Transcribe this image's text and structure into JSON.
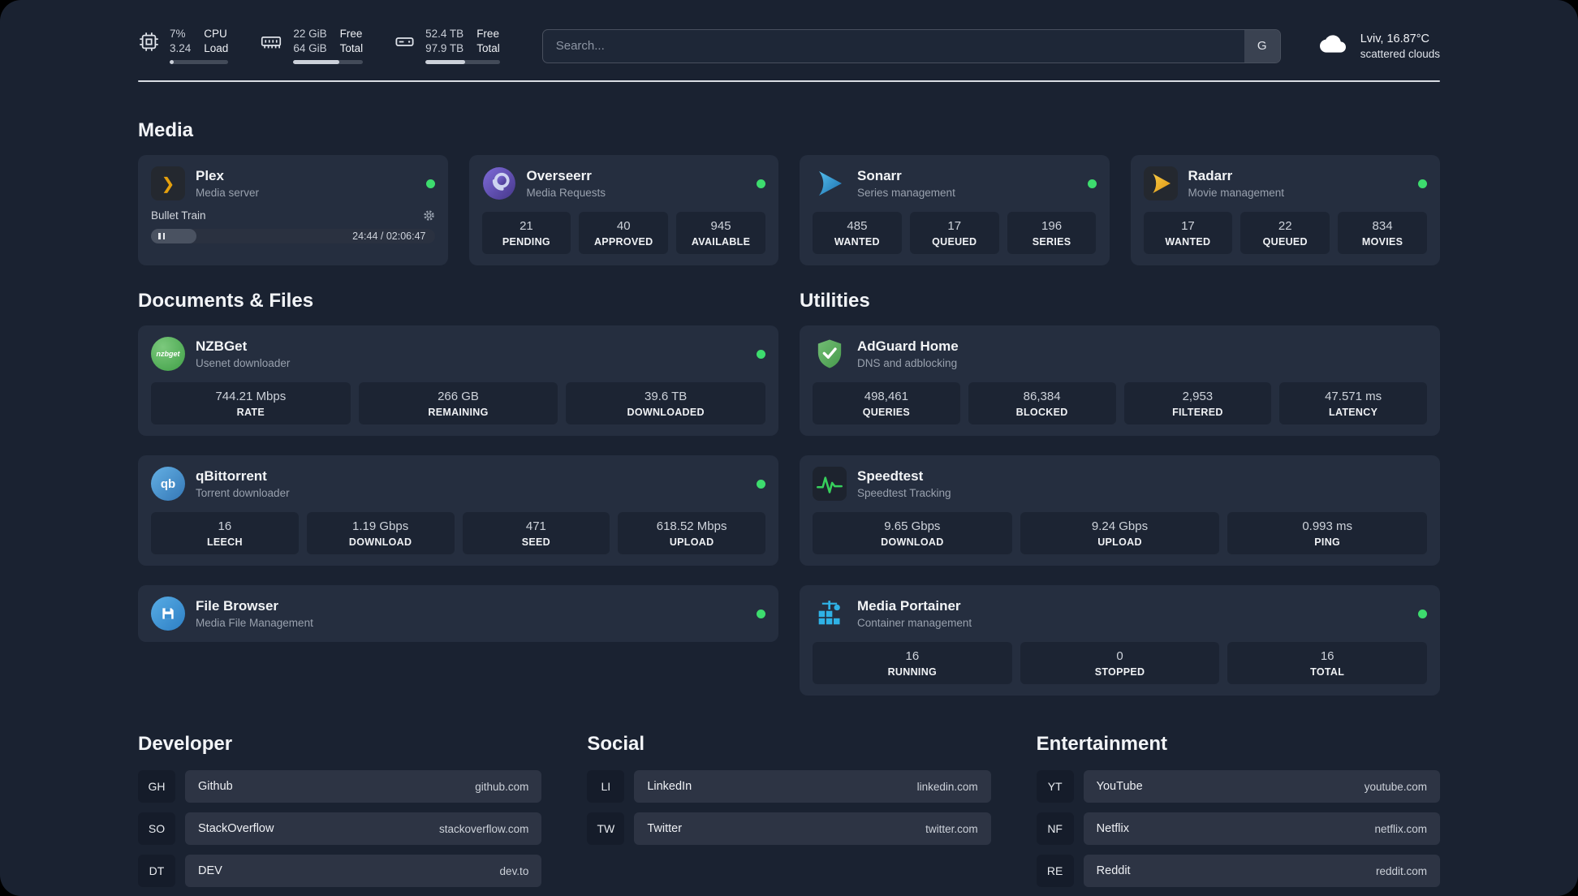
{
  "colors": {
    "background": "#1a2231",
    "card": "#252e3f",
    "tile": "#1c2433",
    "status_online": "#3ddc6e",
    "plex_gold": "#e5a00d",
    "text_primary": "#f2f4f6",
    "text_secondary": "#99a1ae"
  },
  "topbar": {
    "cpu": {
      "value1": "7%",
      "value2": "3.24",
      "label1": "CPU",
      "label2": "Load",
      "progress": 7
    },
    "memory": {
      "value1": "22 GiB",
      "value2": "64 GiB",
      "label1": "Free",
      "label2": "Total",
      "progress": 66
    },
    "disk": {
      "value1": "52.4 TB",
      "value2": "97.9 TB",
      "label1": "Free",
      "label2": "Total",
      "progress": 53
    },
    "search": {
      "placeholder": "Search...",
      "provider": "G"
    },
    "weather": {
      "location": "Lviv, 16.87°C",
      "condition": "scattered clouds"
    }
  },
  "sections": {
    "media": {
      "title": "Media",
      "cards": [
        {
          "name": "Plex",
          "desc": "Media server",
          "online": true,
          "icon_glyph": "❯",
          "player": {
            "track": "Bullet Train",
            "time": "24:44 / 02:06:47",
            "progress": 16
          }
        },
        {
          "name": "Overseerr",
          "desc": "Media Requests",
          "online": true,
          "stats": [
            {
              "value": "21",
              "label": "PENDING"
            },
            {
              "value": "40",
              "label": "APPROVED"
            },
            {
              "value": "945",
              "label": "AVAILABLE"
            }
          ]
        },
        {
          "name": "Sonarr",
          "desc": "Series management",
          "online": true,
          "stats": [
            {
              "value": "485",
              "label": "WANTED"
            },
            {
              "value": "17",
              "label": "QUEUED"
            },
            {
              "value": "196",
              "label": "SERIES"
            }
          ]
        },
        {
          "name": "Radarr",
          "desc": "Movie management",
          "online": true,
          "stats": [
            {
              "value": "17",
              "label": "WANTED"
            },
            {
              "value": "22",
              "label": "QUEUED"
            },
            {
              "value": "834",
              "label": "MOVIES"
            }
          ]
        }
      ]
    },
    "documents": {
      "title": "Documents & Files",
      "cards": [
        {
          "name": "NZBGet",
          "desc": "Usenet downloader",
          "online": true,
          "icon_text": "nzbget",
          "stats": [
            {
              "value": "744.21 Mbps",
              "label": "RATE"
            },
            {
              "value": "266 GB",
              "label": "REMAINING"
            },
            {
              "value": "39.6 TB",
              "label": "DOWNLOADED"
            }
          ]
        },
        {
          "name": "qBittorrent",
          "desc": "Torrent downloader",
          "online": true,
          "icon_text": "qb",
          "stats": [
            {
              "value": "16",
              "label": "LEECH"
            },
            {
              "value": "1.19 Gbps",
              "label": "DOWNLOAD"
            },
            {
              "value": "471",
              "label": "SEED"
            },
            {
              "value": "618.52 Mbps",
              "label": "UPLOAD"
            }
          ]
        },
        {
          "name": "File Browser",
          "desc": "Media File Management",
          "online": true
        }
      ]
    },
    "utilities": {
      "title": "Utilities",
      "cards": [
        {
          "name": "AdGuard Home",
          "desc": "DNS and adblocking",
          "online": false,
          "stats": [
            {
              "value": "498,461",
              "label": "QUERIES"
            },
            {
              "value": "86,384",
              "label": "BLOCKED"
            },
            {
              "value": "2,953",
              "label": "FILTERED"
            },
            {
              "value": "47.571 ms",
              "label": "LATENCY"
            }
          ]
        },
        {
          "name": "Speedtest",
          "desc": "Speedtest Tracking",
          "online": false,
          "stats": [
            {
              "value": "9.65 Gbps",
              "label": "DOWNLOAD"
            },
            {
              "value": "9.24 Gbps",
              "label": "UPLOAD"
            },
            {
              "value": "0.993 ms",
              "label": "PING"
            }
          ]
        },
        {
          "name": "Media Portainer",
          "desc": "Container management",
          "online": true,
          "stats": [
            {
              "value": "16",
              "label": "RUNNING"
            },
            {
              "value": "0",
              "label": "STOPPED"
            },
            {
              "value": "16",
              "label": "TOTAL"
            }
          ]
        }
      ]
    },
    "bookmarks": [
      {
        "title": "Developer",
        "items": [
          {
            "abbr": "GH",
            "name": "Github",
            "domain": "github.com"
          },
          {
            "abbr": "SO",
            "name": "StackOverflow",
            "domain": "stackoverflow.com"
          },
          {
            "abbr": "DT",
            "name": "DEV",
            "domain": "dev.to"
          }
        ]
      },
      {
        "title": "Social",
        "items": [
          {
            "abbr": "LI",
            "name": "LinkedIn",
            "domain": "linkedin.com"
          },
          {
            "abbr": "TW",
            "name": "Twitter",
            "domain": "twitter.com"
          }
        ]
      },
      {
        "title": "Entertainment",
        "items": [
          {
            "abbr": "YT",
            "name": "YouTube",
            "domain": "youtube.com"
          },
          {
            "abbr": "NF",
            "name": "Netflix",
            "domain": "netflix.com"
          },
          {
            "abbr": "RE",
            "name": "Reddit",
            "domain": "reddit.com"
          }
        ]
      }
    ]
  }
}
